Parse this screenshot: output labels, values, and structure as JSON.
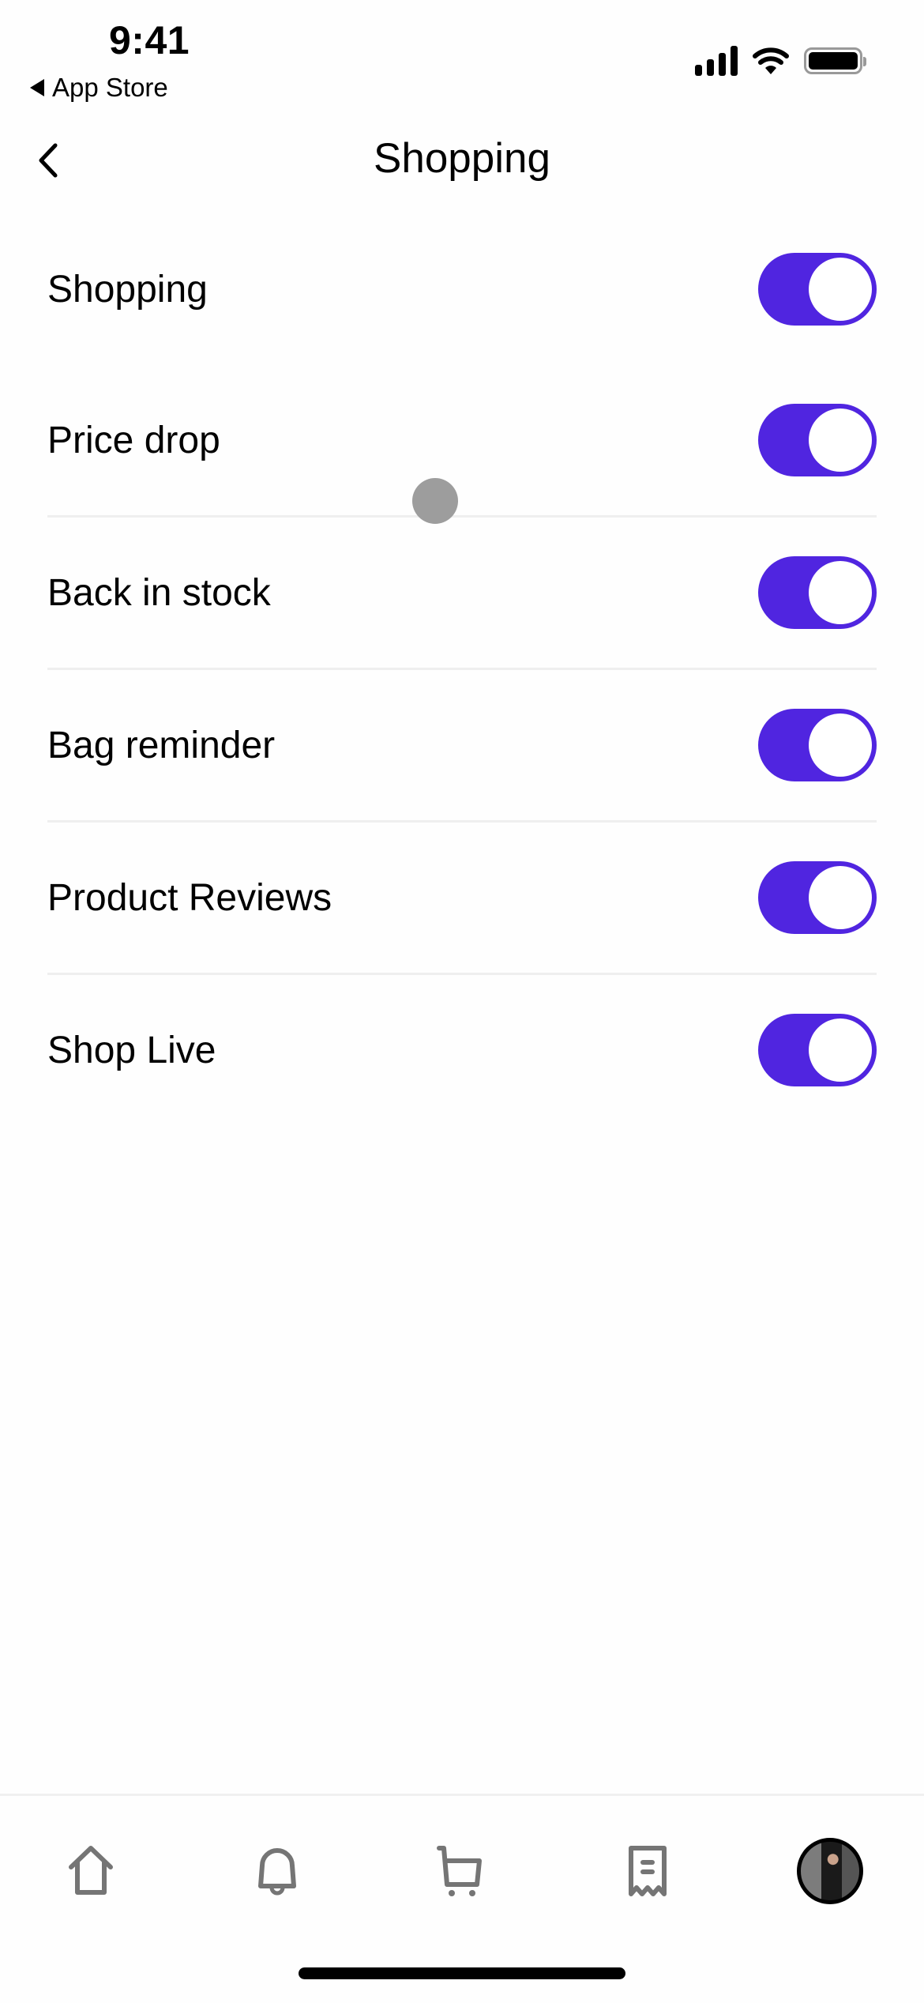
{
  "status_bar": {
    "time": "9:41",
    "back_to_app": "App Store",
    "icons": [
      "cellular-signal-icon",
      "wifi-icon",
      "battery-icon"
    ]
  },
  "nav": {
    "title": "Shopping",
    "back_icon": "chevron-left-icon"
  },
  "settings": [
    {
      "label": "Shopping",
      "enabled": true
    },
    {
      "label": "Price drop",
      "enabled": true
    },
    {
      "label": "Back in stock",
      "enabled": true
    },
    {
      "label": "Bag reminder",
      "enabled": true
    },
    {
      "label": "Product Reviews",
      "enabled": true
    },
    {
      "label": "Shop Live",
      "enabled": true
    }
  ],
  "colors": {
    "accent": "#5025e0",
    "tab_icon": "#757575",
    "divider": "#efefef"
  },
  "tab_bar": {
    "tabs": [
      {
        "name": "home",
        "icon": "home-icon"
      },
      {
        "name": "notifications",
        "icon": "bell-icon"
      },
      {
        "name": "cart",
        "icon": "cart-icon"
      },
      {
        "name": "orders",
        "icon": "receipt-icon"
      },
      {
        "name": "profile",
        "icon": "avatar"
      }
    ]
  }
}
